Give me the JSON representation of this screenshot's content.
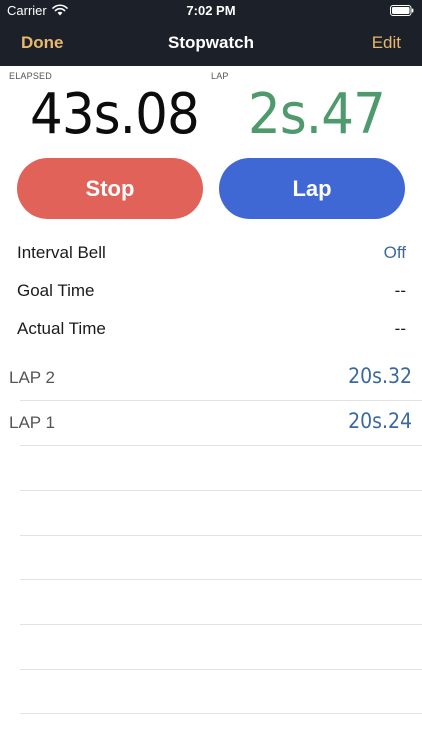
{
  "status_bar": {
    "carrier": "Carrier",
    "time": "7:02 PM",
    "wifi_icon": "wifi-icon",
    "battery_icon": "battery-icon"
  },
  "nav": {
    "left_button": "Done",
    "title": "Stopwatch",
    "right_button": "Edit"
  },
  "timer": {
    "elapsed_label": "ELAPSED",
    "elapsed_value": "43s.08",
    "lap_label": "LAP",
    "lap_value": "2s.47"
  },
  "buttons": {
    "stop": "Stop",
    "lap": "Lap"
  },
  "info": {
    "interval_bell": {
      "label": "Interval Bell",
      "value": "Off"
    },
    "goal_time": {
      "label": "Goal Time",
      "value": "--"
    },
    "actual_time": {
      "label": "Actual Time",
      "value": "--"
    }
  },
  "laps": [
    {
      "name": "LAP 2",
      "time": "20s.32"
    },
    {
      "name": "LAP 1",
      "time": "20s.24"
    }
  ],
  "colors": {
    "header_bg": "#1b2029",
    "nav_accent": "#e8b86c",
    "stop_button": "#e16259",
    "lap_button": "#4068d5",
    "lap_value_green": "#4f9a6c",
    "link_blue": "#3a6a9e"
  }
}
